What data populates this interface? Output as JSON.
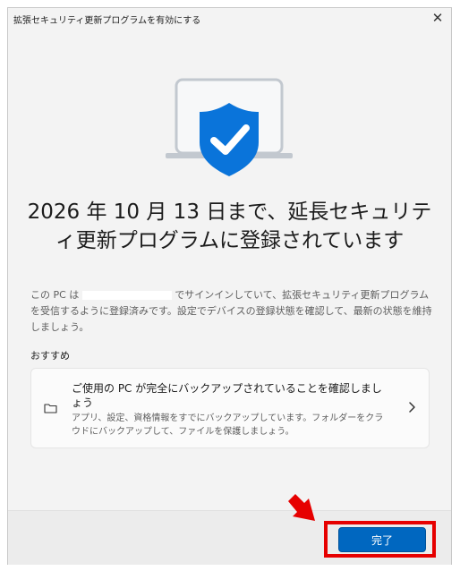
{
  "window": {
    "title": "拡張セキュリティ更新プログラムを有効にする",
    "close_glyph": "✕"
  },
  "content": {
    "headline_line1": "2026 年 10 月 13 日まで、延長セキュリテ",
    "headline_line2": "ィ更新プログラムに登録されています",
    "description_part1": "この PC は",
    "description_part2": "でサインインしていて、拡張セキュリティ更新プログラムを受信するように登録済みです。設定でデバイスの登録状態を確認して、最新の状態を維持しましょう。",
    "recommended_label": "おすすめ"
  },
  "card": {
    "title": "ご使用の PC が完全にバックアップされていることを確認しましょう",
    "description": "アプリ、設定、資格情報をすでにバックアップしています。フォルダーをクラウドにバックアップして、ファイルを保護しましょう。",
    "icon": "folder-icon"
  },
  "footer": {
    "done_label": "完了"
  },
  "colors": {
    "accent": "#0067c0",
    "shield": "#0a74da",
    "highlight": "#e60000"
  }
}
